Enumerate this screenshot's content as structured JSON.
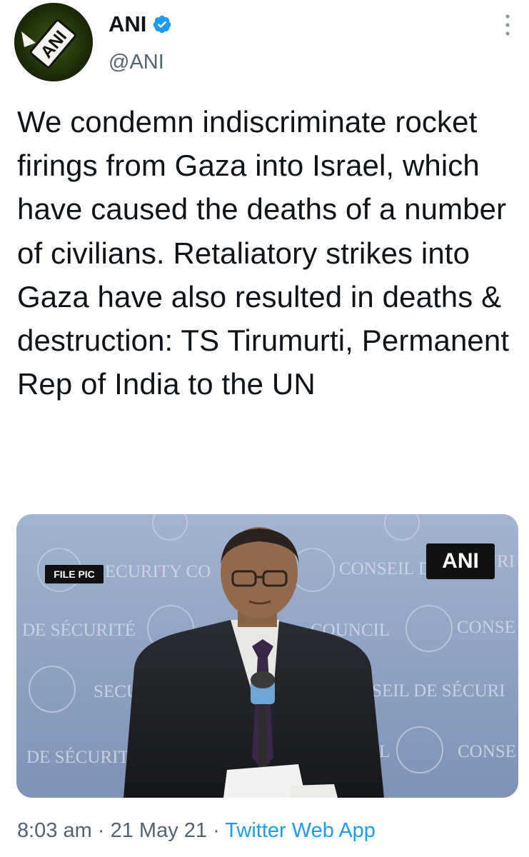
{
  "author": {
    "name": "ANI",
    "handle": "@ANI",
    "verified": true,
    "avatar_logo_text": "ANI"
  },
  "tweet": {
    "text": "We condemn indiscriminate rocket firings from Gaza into Israel, which have caused the deaths of a number of civilians. Retaliatory strikes into Gaza have also resulted in deaths & destruction: TS Tirumurti, Permanent Rep of India to the UN"
  },
  "media": {
    "badge": "FILE PIC",
    "watermark": "ANI",
    "backdrop_texts": [
      "SECURITY CO",
      "CONSEIL D",
      "URI",
      "DE SÉCURITÉ",
      "COUNCIL",
      "CONSE",
      "SECUR",
      "NSEIL DE SÉCURI",
      "DE SÉCURIT",
      "L",
      "CONSE"
    ]
  },
  "meta": {
    "time": "8:03 am",
    "separator": "·",
    "date": "21 May 21",
    "source": "Twitter Web App"
  },
  "colors": {
    "text": "#0f1419",
    "secondary": "#536471",
    "link": "#1d9bf0",
    "verified": "#1d9bf0",
    "backdrop": "#8d9fc0"
  },
  "icons": {
    "verified": "verified-badge-icon",
    "more": "more-options-icon"
  }
}
